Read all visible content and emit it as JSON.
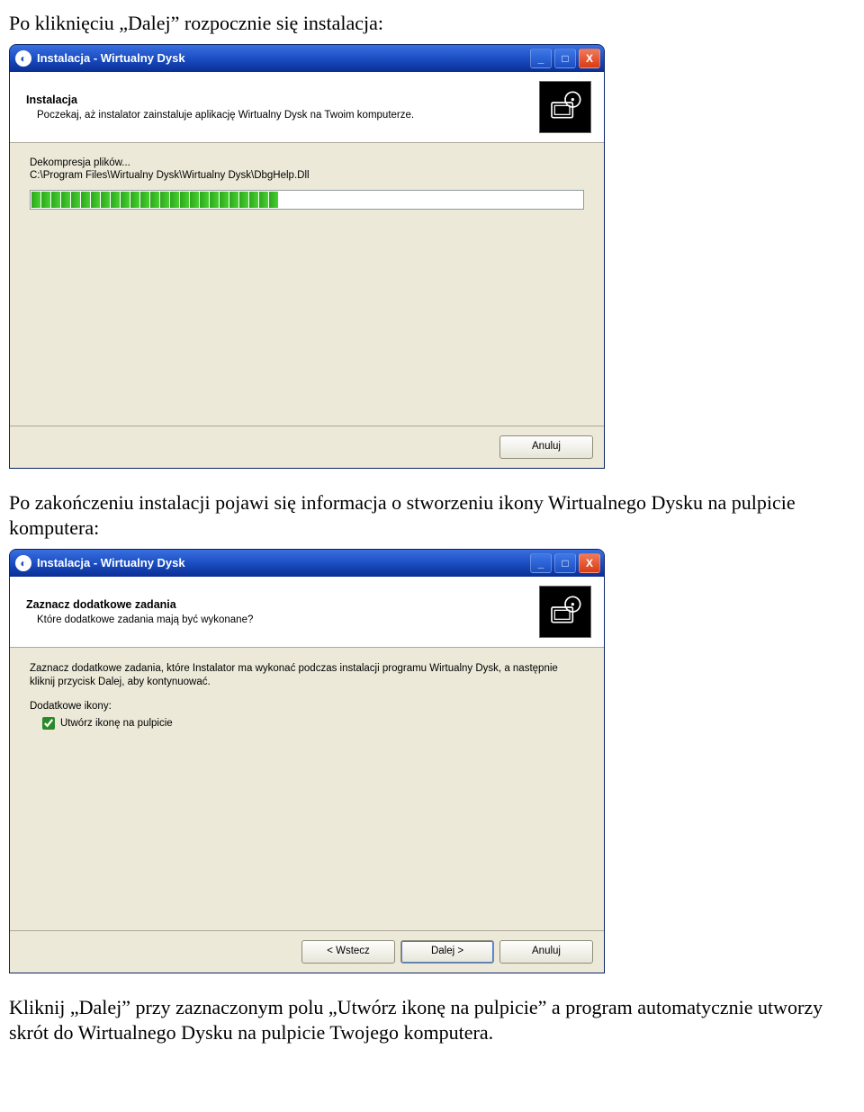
{
  "doc": {
    "para1": "Po kliknięciu „Dalej” rozpocznie się instalacja:",
    "para2": "Po zakończeniu instalacji pojawi się informacja o stworzeniu ikony Wirtualnego Dysku na pulpicie komputera:",
    "para3": "Kliknij „Dalej” przy zaznaczonym polu „Utwórz ikonę na pulpicie” a program automatycznie utworzy skrót do Wirtualnego Dysku na pulpicie Twojego komputera."
  },
  "win_common": {
    "title": "Instalacja - Wirtualny Dysk",
    "min_icon": "_",
    "max_icon": "□",
    "close_icon": "X"
  },
  "win1": {
    "head_title": "Instalacja",
    "head_sub": "Poczekaj, aż instalator zainstaluje aplikację Wirtualny Dysk na Twoim komputerze.",
    "status1": "Dekompresja plików...",
    "status2": "C:\\Program Files\\Wirtualny Dysk\\Wirtualny Dysk\\DbgHelp.Dll",
    "progress_segments": 25,
    "btn_cancel": "Anuluj"
  },
  "win2": {
    "head_title": "Zaznacz dodatkowe zadania",
    "head_sub": "Które dodatkowe zadania mają być wykonane?",
    "intro": "Zaznacz dodatkowe zadania, które Instalator ma wykonać podczas instalacji programu Wirtualny Dysk, a następnie kliknij przycisk Dalej, aby kontynuować.",
    "group_label": "Dodatkowe ikony:",
    "check_label": "Utwórz ikonę na pulpicie",
    "checked": true,
    "btn_back": "< Wstecz",
    "btn_next": "Dalej >",
    "btn_cancel": "Anuluj"
  }
}
